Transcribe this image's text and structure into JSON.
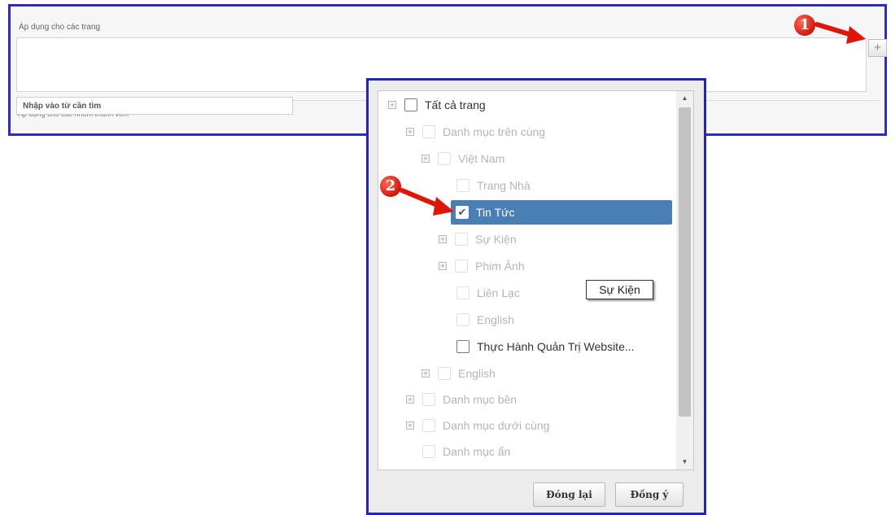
{
  "background_form": {
    "pages_label": "Áp dụng cho các trang",
    "search_placeholder": "Nhập vào từ cần tìm",
    "members_label": "Áp dụng cho các nhóm thành viên",
    "add_button": "+"
  },
  "annotations": {
    "marker1": "1",
    "marker2": "2"
  },
  "dialog": {
    "tree": [
      {
        "label": "Tất cả trang"
      },
      {
        "label": "Danh mục trên cùng"
      },
      {
        "label": "Việt Nam"
      },
      {
        "label": "Trang Nhà"
      },
      {
        "label": "Tin Tức",
        "checked_glyph": "✔"
      },
      {
        "label": "Sự Kiện"
      },
      {
        "label": "Phim Ảnh"
      },
      {
        "label": "Liên Lạc"
      },
      {
        "label": "English"
      },
      {
        "label": "Thực Hành Quản Trị Website..."
      },
      {
        "label": "English"
      },
      {
        "label": "Danh mục bên"
      },
      {
        "label": "Danh mục dưới cùng"
      },
      {
        "label": "Danh mục ẩn"
      }
    ],
    "expander_glyph": "+",
    "tooltip": "Sự Kiện",
    "close_label": "Đóng lại",
    "ok_label": "Đồng ý",
    "scroll_up": "▲",
    "scroll_down": "▼"
  }
}
